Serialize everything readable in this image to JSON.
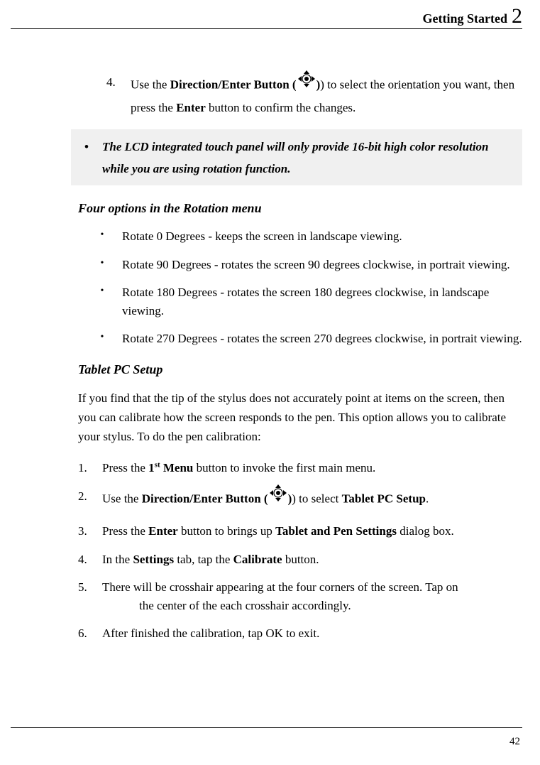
{
  "header": {
    "title": "Getting Started",
    "chapter": "2"
  },
  "step4": {
    "num": "4.",
    "t1": "Use the ",
    "bold1": "Direction/Enter Button (",
    "t2": ") to select the orientation you want, then press the ",
    "bold2": "Enter",
    "t3": " button to confirm the changes."
  },
  "note": {
    "bullet": "•",
    "text": "The LCD integrated touch panel will only provide 16-bit high color resolution while you are using rotation function."
  },
  "section1": "Four options in the Rotation menu",
  "bullets": [
    "Rotate 0 Degrees - keeps the screen in landscape viewing.",
    "Rotate 90 Degrees - rotates the screen 90 degrees clockwise, in portrait viewing.",
    "Rotate 180 Degrees - rotates the screen 180 degrees clockwise, in landscape viewing.",
    "Rotate 270 Degrees - rotates the screen 270 degrees clockwise, in portrait viewing."
  ],
  "bulletMark": "•",
  "section2": "Tablet PC Setup",
  "para": "If you find that the tip of the stylus does not accurately point at items on the screen, then you can calibrate how the screen responds to the pen. This option allows you to calibrate your stylus. To do the pen calibration:",
  "ol": {
    "i1": {
      "num": "1.",
      "a": "Press the ",
      "b1": "1",
      "sup": "st",
      "b2": " Menu",
      "c": " button to invoke the first main menu."
    },
    "i2": {
      "num": "2.",
      "a": "Use the ",
      "b": "Direction/Enter Button (",
      "c": ") to select ",
      "d": "Tablet PC Setup",
      "e": "."
    },
    "i3": {
      "num": "3.",
      "a": "Press the ",
      "b": "Enter",
      "c": " button to brings up ",
      "d": "Tablet and Pen Settings",
      "e": " dialog box."
    },
    "i4": {
      "num": "4.",
      "a": "In the ",
      "b": "Settings",
      "c": " tab, tap the ",
      "d": "Calibrate",
      "e": " button."
    },
    "i5": {
      "num": "5.",
      "a": "There will be crosshair appearing at the four corners of the screen. Tap on ",
      "b": "the center of the each crosshair accordingly."
    },
    "i6": {
      "num": "6.",
      "a": "After finished the calibration, tap OK to exit."
    }
  },
  "pageNum": "42"
}
